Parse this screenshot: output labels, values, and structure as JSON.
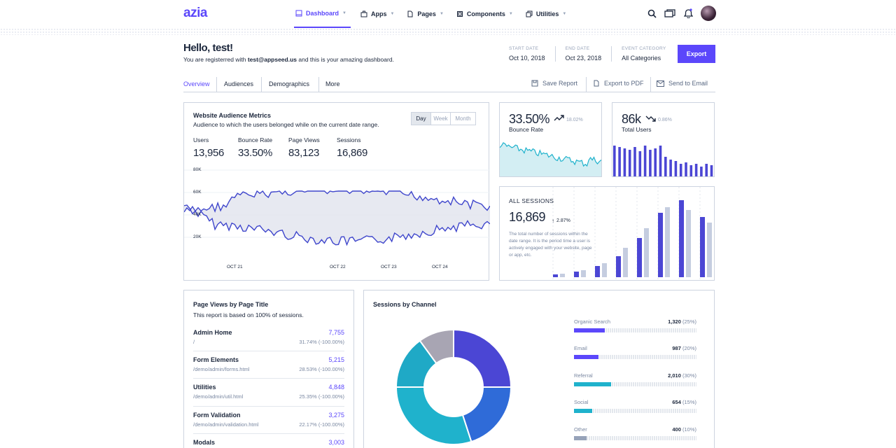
{
  "header": {
    "logo": "azia",
    "nav": [
      {
        "label": "Dashboard",
        "icon": "layout-icon"
      },
      {
        "label": "Apps",
        "icon": "briefcase-icon"
      },
      {
        "label": "Pages",
        "icon": "file-icon"
      },
      {
        "label": "Components",
        "icon": "box-icon"
      },
      {
        "label": "Utilities",
        "icon": "layers-icon"
      }
    ]
  },
  "page": {
    "greeting": "Hello, test!",
    "sub_prefix": "You are registerred with ",
    "email": "test@appseed.us",
    "sub_suffix": " and this is your amazing dashboard.",
    "start_label": "START DATE",
    "start_value": "Oct 10, 2018",
    "end_label": "END DATE",
    "end_value": "Oct 23, 2018",
    "cat_label": "EVENT CATEGORY",
    "cat_value": "All Categories",
    "export": "Export"
  },
  "tabs": [
    "Overview",
    "Audiences",
    "Demographics",
    "More"
  ],
  "actions": [
    "Save Report",
    "Export to PDF",
    "Send to Email"
  ],
  "audience": {
    "title": "Website Audience Metrics",
    "subtitle": "Audience to which the users belonged while on the current date range.",
    "segments": [
      "Day",
      "Week",
      "Month"
    ],
    "metrics": [
      {
        "label": "Users",
        "value": "13,956"
      },
      {
        "label": "Bounce Rate",
        "value": "33.50%"
      },
      {
        "label": "Page Views",
        "value": "83,123"
      },
      {
        "label": "Sessions",
        "value": "16,869"
      }
    ],
    "y_ticks": [
      "80K",
      "60K",
      "40K",
      "20K"
    ],
    "x_ticks": [
      "OCT 21",
      "OCT 22",
      "OCT 23",
      "OCT 24"
    ]
  },
  "bounce": {
    "value": "33.50%",
    "pct": "18.02%",
    "label": "Bounce Rate"
  },
  "users": {
    "value": "86k",
    "pct": "0.86%",
    "label": "Total Users"
  },
  "sessions": {
    "title": "ALL SESSIONS",
    "value": "16,869",
    "pct": "2.87%",
    "desc": "The total number of sessions within the date range. It is the period time a user is actively engaged with your website, page or app, etc."
  },
  "pageviews": {
    "title": "Page Views by Page Title",
    "subtitle": "This report is based on 100% of sessions.",
    "rows": [
      {
        "title": "Admin Home",
        "value": "7,755",
        "path": "/",
        "pct": "31.74% (-100.00%)"
      },
      {
        "title": "Form Elements",
        "value": "5,215",
        "path": "/demo/admin/forms.html",
        "pct": "28.53% (-100.00%)"
      },
      {
        "title": "Utilities",
        "value": "4,848",
        "path": "/demo/admin/util.html",
        "pct": "25.35% (-100.00%)"
      },
      {
        "title": "Form Validation",
        "value": "3,275",
        "path": "/demo/admin/validation.html",
        "pct": "22.17% (-100.00%)"
      },
      {
        "title": "Modals",
        "value": "3,003",
        "path": "",
        "pct": ""
      }
    ]
  },
  "channels": {
    "title": "Sessions by Channel",
    "rows": [
      {
        "name": "Organic Search",
        "value": "1,320",
        "pct": "(25%)",
        "fraction": 0.25,
        "color": "#5b47fb"
      },
      {
        "name": "Email",
        "value": "987",
        "pct": "(20%)",
        "fraction": 0.2,
        "color": "#5b47fb"
      },
      {
        "name": "Referral",
        "value": "2,010",
        "pct": "(30%)",
        "fraction": 0.3,
        "color": "#1fb2cc"
      },
      {
        "name": "Social",
        "value": "654",
        "pct": "(15%)",
        "fraction": 0.15,
        "color": "#1fb2cc"
      },
      {
        "name": "Other",
        "value": "400",
        "pct": "(10%)",
        "fraction": 0.1,
        "color": "#97a3b9"
      }
    ]
  },
  "chart_data": [
    {
      "type": "pie",
      "title": "Sessions by Channel",
      "categories": [
        "Organic Search",
        "Email",
        "Referral",
        "Social",
        "Other"
      ],
      "values": [
        25,
        20,
        30,
        15,
        10
      ],
      "colors": [
        "#4b46d4",
        "#2f6bd8",
        "#1fb2cc",
        "#1fa9c6",
        "#a8a5b3"
      ]
    }
  ]
}
